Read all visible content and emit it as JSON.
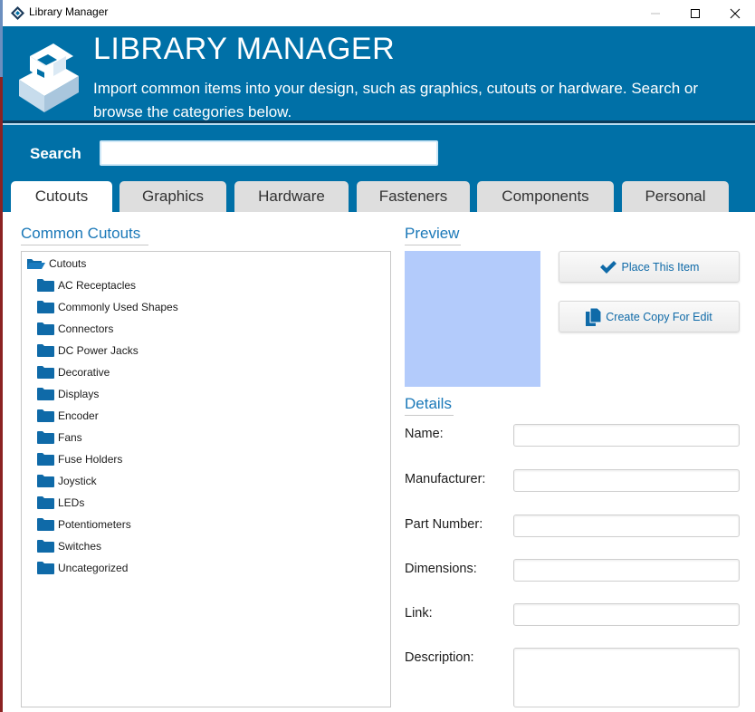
{
  "window": {
    "title": "Library Manager",
    "controls": {
      "minimize": "minimize",
      "maximize": "maximize",
      "close": "close"
    }
  },
  "header": {
    "title": "LIBRARY MANAGER",
    "subtitle": "Import common items into your design, such as graphics, cutouts or hardware. Search or browse the categories below.",
    "logo": "pd-logo-icon"
  },
  "search": {
    "label": "Search",
    "value": "",
    "placeholder": ""
  },
  "tabs": [
    {
      "label": "Cutouts",
      "active": true
    },
    {
      "label": "Graphics",
      "active": false
    },
    {
      "label": "Hardware",
      "active": false
    },
    {
      "label": "Fasteners",
      "active": false
    },
    {
      "label": "Components",
      "active": false
    },
    {
      "label": "Personal",
      "active": false
    }
  ],
  "tree": {
    "title": "Common Cutouts",
    "root": {
      "label": "Cutouts",
      "icon": "folder-open-icon",
      "expanded": true
    },
    "children": [
      {
        "label": "AC Receptacles",
        "icon": "folder-icon"
      },
      {
        "label": "Commonly Used Shapes",
        "icon": "folder-icon"
      },
      {
        "label": "Connectors",
        "icon": "folder-icon"
      },
      {
        "label": "DC Power Jacks",
        "icon": "folder-icon"
      },
      {
        "label": "Decorative",
        "icon": "folder-icon"
      },
      {
        "label": "Displays",
        "icon": "folder-icon"
      },
      {
        "label": "Encoder",
        "icon": "folder-icon"
      },
      {
        "label": "Fans",
        "icon": "folder-icon"
      },
      {
        "label": "Fuse Holders",
        "icon": "folder-icon"
      },
      {
        "label": "Joystick",
        "icon": "folder-icon"
      },
      {
        "label": "LEDs",
        "icon": "folder-icon"
      },
      {
        "label": "Potentiometers",
        "icon": "folder-icon"
      },
      {
        "label": "Switches",
        "icon": "folder-icon"
      },
      {
        "label": "Uncategorized",
        "icon": "folder-icon"
      }
    ]
  },
  "preview": {
    "title": "Preview",
    "color": "#b3cbfb"
  },
  "actions": {
    "place": {
      "label": "Place This Item",
      "icon": "checkmark-icon"
    },
    "copy": {
      "label": "Create Copy For Edit",
      "icon": "copy-icon"
    }
  },
  "details": {
    "title": "Details",
    "fields": [
      {
        "label": "Name:",
        "value": ""
      },
      {
        "label": "Manufacturer:",
        "value": ""
      },
      {
        "label": "Part Number:",
        "value": ""
      },
      {
        "label": "Dimensions:",
        "value": ""
      },
      {
        "label": "Link:",
        "value": ""
      },
      {
        "label": "Description:",
        "value": ""
      }
    ]
  },
  "colors": {
    "brand_blue": "#0070a7",
    "accent_text": "#1a78b8",
    "tab_inactive": "#dedede"
  }
}
